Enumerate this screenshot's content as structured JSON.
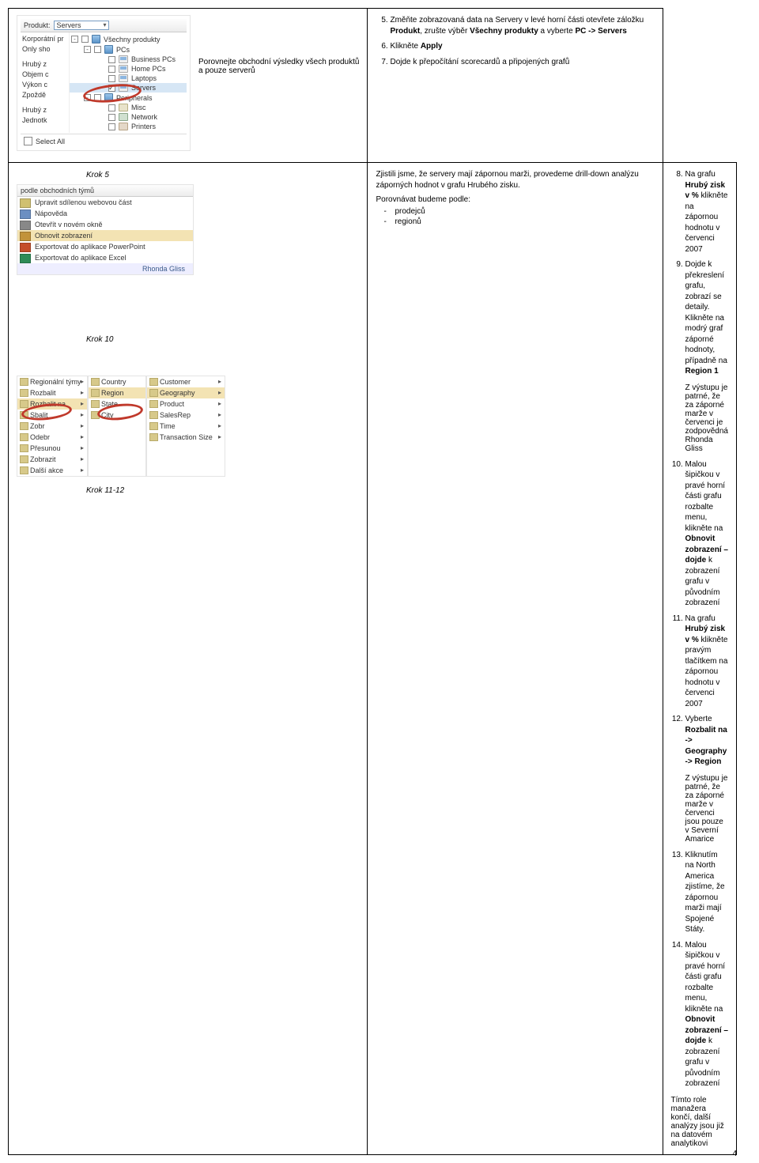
{
  "row1": {
    "instr": "Porovnejte obchodní výsledky všech produktů a pouze serverů",
    "steps": [
      {
        "n": 5,
        "text_pre": "Změňte zobrazovaná data na Servery v levé horní části otevřete záložku ",
        "b1": "Produkt",
        "mid1": ", zrušte výběr ",
        "b2": "Všechny produkty",
        "mid2": " a vyberte ",
        "b3": "PC -> Servers"
      },
      {
        "n": 6,
        "text_pre": "Klikněte ",
        "b1": "Apply"
      },
      {
        "n": 7,
        "plain": "Dojde k přepočítání scorecardů a připojených grafů"
      }
    ],
    "shot": {
      "header_label": "Produkt:",
      "header_dd": "Servers",
      "metrics": [
        "Korporátní pr",
        "Only sho",
        "Hrubý z",
        "Objem c",
        "Výkon c",
        "Zpoždě",
        "Hrubý z",
        "Jednotk"
      ],
      "tree": [
        {
          "lvl": 0,
          "chk": false,
          "toggle": "-",
          "label": "Všechny produkty",
          "icon": "blue-cube"
        },
        {
          "lvl": 1,
          "chk": false,
          "toggle": "-",
          "label": "PCs",
          "icon": "blue-cube"
        },
        {
          "lvl": 2,
          "chk": false,
          "toggle": "",
          "label": "Business PCs",
          "icon": "pc-ic"
        },
        {
          "lvl": 2,
          "chk": false,
          "toggle": "",
          "label": "Home PCs",
          "icon": "pc-ic"
        },
        {
          "lvl": 2,
          "chk": false,
          "toggle": "",
          "label": "Laptops",
          "icon": "pc-ic"
        },
        {
          "lvl": 2,
          "chk": true,
          "toggle": "",
          "label": "Servers",
          "icon": "pc-ic",
          "highlight": true
        },
        {
          "lvl": 1,
          "chk": false,
          "toggle": "-",
          "label": "Peripherals",
          "icon": "blue-cube"
        },
        {
          "lvl": 2,
          "chk": false,
          "toggle": "",
          "label": "Misc",
          "icon": "disk-ic"
        },
        {
          "lvl": 2,
          "chk": false,
          "toggle": "",
          "label": "Network",
          "icon": "net-ic"
        },
        {
          "lvl": 2,
          "chk": false,
          "toggle": "",
          "label": "Printers",
          "icon": "prn-ic"
        }
      ],
      "select_all": "Select All"
    }
  },
  "row2": {
    "left": {
      "krok5": "Krok 5",
      "krok10": "Krok 10",
      "krok1112": "Krok 11-12",
      "list5_header": "podle obchodních týmů",
      "list5": [
        "Regionální týmy",
        "Nápověda"
      ],
      "ctx": [
        {
          "label": "Upravit sdílenou webovou část",
          "ic": "#d0c070"
        },
        {
          "label": "Nápověda",
          "ic": "#6b8fc2"
        },
        {
          "label": "Otevřít v novém okně",
          "ic": "#888"
        },
        {
          "label": "Obnovit zobrazení",
          "sel": true,
          "ic": "#c2933a"
        },
        {
          "label": "Exportovat do aplikace PowerPoint",
          "ic": "#c54e2a"
        },
        {
          "label": "Exportovat do aplikace Excel",
          "ic": "#2e8b57"
        }
      ],
      "ctx_footer": "Rhonda Gliss",
      "menu_bottom": {
        "left": [
          "Regionální týmy",
          "Rozbalit",
          "Rozbalit na",
          "Sbalit",
          "Zobr",
          "Odebr",
          "Přesunou",
          "Zobrazit",
          "Další akce"
        ],
        "sub1": [
          "Customer",
          "Geography",
          "Product",
          "SalesRep",
          "Time",
          "Transaction Size"
        ],
        "sub2": [
          "Country",
          "Region",
          "State",
          "City"
        ]
      }
    },
    "mid": {
      "intro": "Zjistili jsme, že servery mají zápornou marži, provedeme drill-down analýzu záporných hodnot v grafu Hrubého zisku.",
      "p2": "Porovnávat budeme podle:",
      "bullets": [
        "prodejců",
        "regionů"
      ]
    },
    "right": {
      "steps_a": [
        {
          "n": 8,
          "pre": "Na grafu ",
          "b": "Hrubý zisk v %",
          "post": " klikněte na zápornou hodnotu v červenci 2007"
        },
        {
          "n": 9,
          "pre": "Dojde k překreslení grafu, zobrazí se detaily. Klikněte na modrý graf záporné hodnoty, případně na ",
          "b": "Region 1",
          "post": ""
        }
      ],
      "note1": "Z výstupu je patrné, že za záporné marže v červenci je zodpovědná Rhonda Gliss",
      "steps_b": [
        {
          "n": 10,
          "pre": "Malou šipičkou v pravé horní části grafu rozbalte menu, klikněte na ",
          "b": "Obnovit zobrazení – dojde",
          "post": " k zobrazení grafu v původním zobrazení"
        },
        {
          "n": 11,
          "pre": "Na grafu ",
          "b": "Hrubý zisk v %",
          "post": " klikněte pravým tlačítkem na zápornou hodnotu v červenci 2007"
        },
        {
          "n": 12,
          "pre": "Vyberte ",
          "b": "Rozbalit na -> Geography -> Region",
          "post": ""
        }
      ],
      "note2": "Z výstupu je patrné, že za záporné marže v červenci jsou pouze v Severní Amarice",
      "steps_c": [
        {
          "n": 13,
          "plain": "Kliknutím na North America zjistíme, že zápornou marži mají Spojené Státy."
        },
        {
          "n": 14,
          "pre": "Malou šipičkou v pravé horní části grafu rozbalte menu, klikněte na ",
          "b": "Obnovit zobrazení – dojde",
          "post": " k zobrazení grafu v původním zobrazení"
        }
      ],
      "closing": "Tímto role manažera končí, další analýzy jsou již na datovém analytikovi"
    }
  },
  "page_no": "4"
}
